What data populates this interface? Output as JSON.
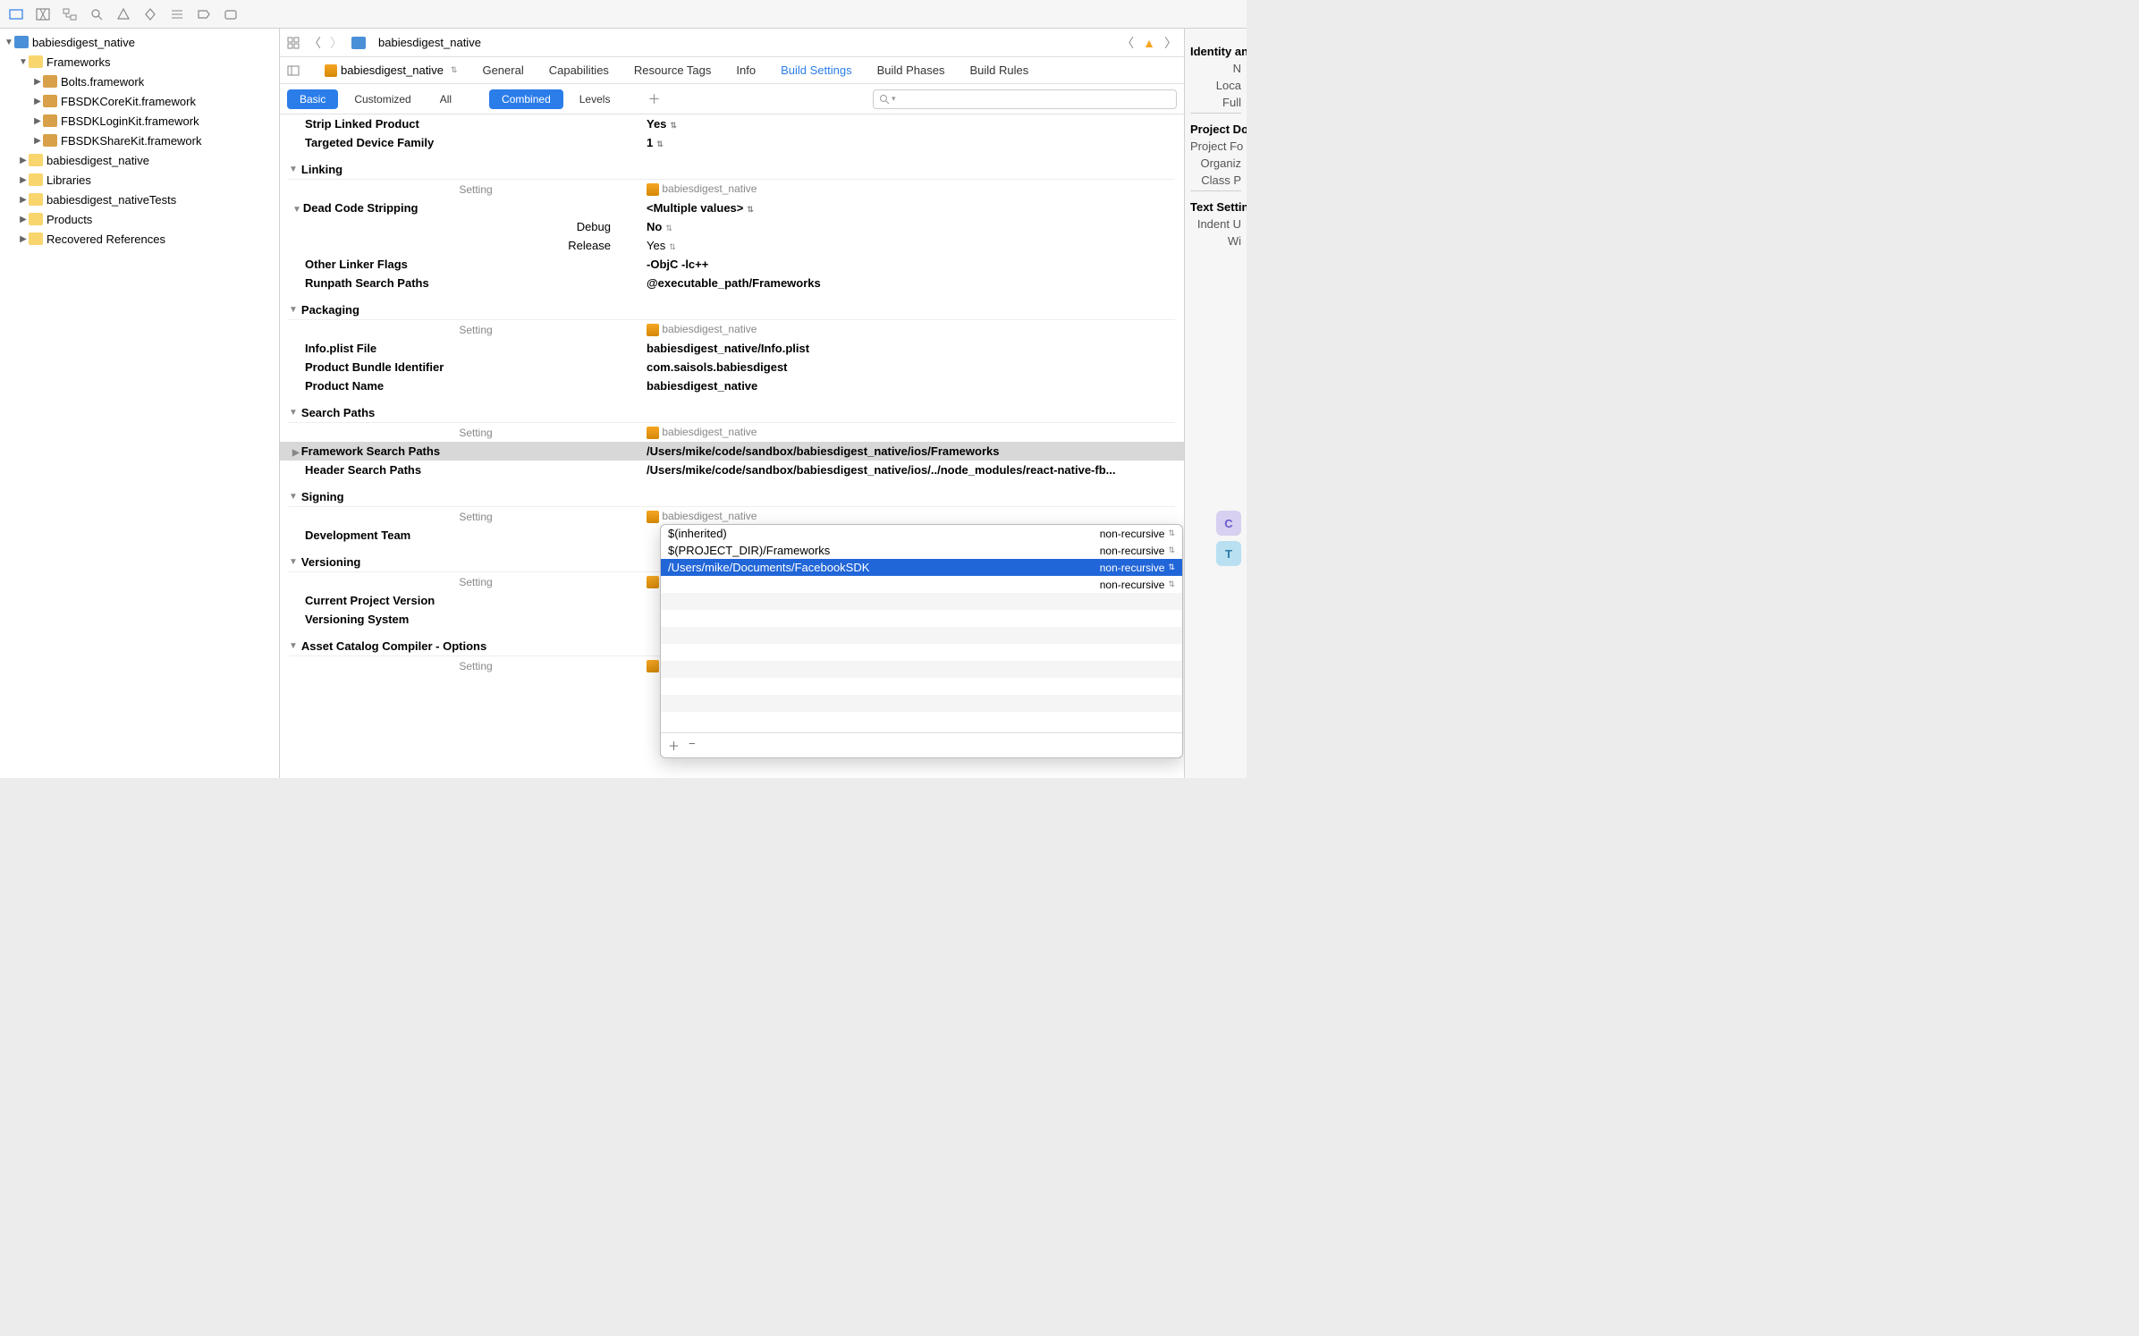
{
  "breadcrumb": {
    "title": "babiesdigest_native"
  },
  "navigator": {
    "project": "babiesdigest_native",
    "folders": [
      {
        "label": "Frameworks",
        "expanded": true,
        "children": [
          {
            "label": "Bolts.framework",
            "type": "framework"
          },
          {
            "label": "FBSDKCoreKit.framework",
            "type": "framework"
          },
          {
            "label": "FBSDKLoginKit.framework",
            "type": "framework"
          },
          {
            "label": "FBSDKShareKit.framework",
            "type": "framework"
          }
        ]
      },
      {
        "label": "babiesdigest_native"
      },
      {
        "label": "Libraries"
      },
      {
        "label": "babiesdigest_nativeTests"
      },
      {
        "label": "Products"
      },
      {
        "label": "Recovered References"
      }
    ]
  },
  "target": "babiesdigest_native",
  "tabs": [
    "General",
    "Capabilities",
    "Resource Tags",
    "Info",
    "Build Settings",
    "Build Phases",
    "Build Rules"
  ],
  "active_tab": "Build Settings",
  "filters": {
    "basic": "Basic",
    "customized": "Customized",
    "all": "All",
    "combined": "Combined",
    "levels": "Levels"
  },
  "column_headers": {
    "setting": "Setting",
    "target_name": "babiesdigest_native"
  },
  "settings": {
    "strip_linked": {
      "key": "Strip Linked Product",
      "val": "Yes"
    },
    "targeted_device": {
      "key": "Targeted Device Family",
      "val": "1"
    },
    "linking": "Linking",
    "dead_code": {
      "key": "Dead Code Stripping",
      "val": "<Multiple values>"
    },
    "debug": {
      "key": "Debug",
      "val": "No"
    },
    "release": {
      "key": "Release",
      "val": "Yes"
    },
    "other_linker": {
      "key": "Other Linker Flags",
      "val": "-ObjC -lc++"
    },
    "runpath": {
      "key": "Runpath Search Paths",
      "val": "@executable_path/Frameworks"
    },
    "packaging": "Packaging",
    "infoplist": {
      "key": "Info.plist File",
      "val": "babiesdigest_native/Info.plist"
    },
    "bundle_id": {
      "key": "Product Bundle Identifier",
      "val": "com.saisols.babiesdigest"
    },
    "product_name": {
      "key": "Product Name",
      "val": "babiesdigest_native"
    },
    "search_paths": "Search Paths",
    "framework_search": {
      "key": "Framework Search Paths",
      "val": "/Users/mike/code/sandbox/babiesdigest_native/ios/Frameworks"
    },
    "header_search": {
      "key": "Header Search Paths",
      "val": "/Users/mike/code/sandbox/babiesdigest_native/ios/../node_modules/react-native-fb..."
    },
    "signing": "Signing",
    "dev_team": {
      "key": "Development Team",
      "val": ""
    },
    "versioning": "Versioning",
    "current_version": {
      "key": "Current Project Version",
      "val": ""
    },
    "versioning_system": {
      "key": "Versioning System",
      "val": ""
    },
    "asset_catalog": "Asset Catalog Compiler - Options"
  },
  "popup": {
    "rows": [
      {
        "path": "$(inherited)",
        "rec": "non-recursive",
        "selected": false
      },
      {
        "path": "$(PROJECT_DIR)/Frameworks",
        "rec": "non-recursive",
        "selected": false
      },
      {
        "path": "/Users/mike/Documents/FacebookSDK",
        "rec": "non-recursive",
        "selected": true
      },
      {
        "path": "",
        "rec": "non-recursive",
        "selected": false
      }
    ]
  },
  "right_panel": {
    "identity": "Identity and",
    "n": "N",
    "loca": "Loca",
    "full": "Full",
    "project_doc": "Project Do",
    "project_fo": "Project Fo",
    "organiz": "Organiz",
    "class_p": "Class P",
    "text_settings": "Text Settin",
    "indent_u": "Indent U",
    "wi": "Wi",
    "badge_c": "C",
    "badge_t": "T"
  }
}
